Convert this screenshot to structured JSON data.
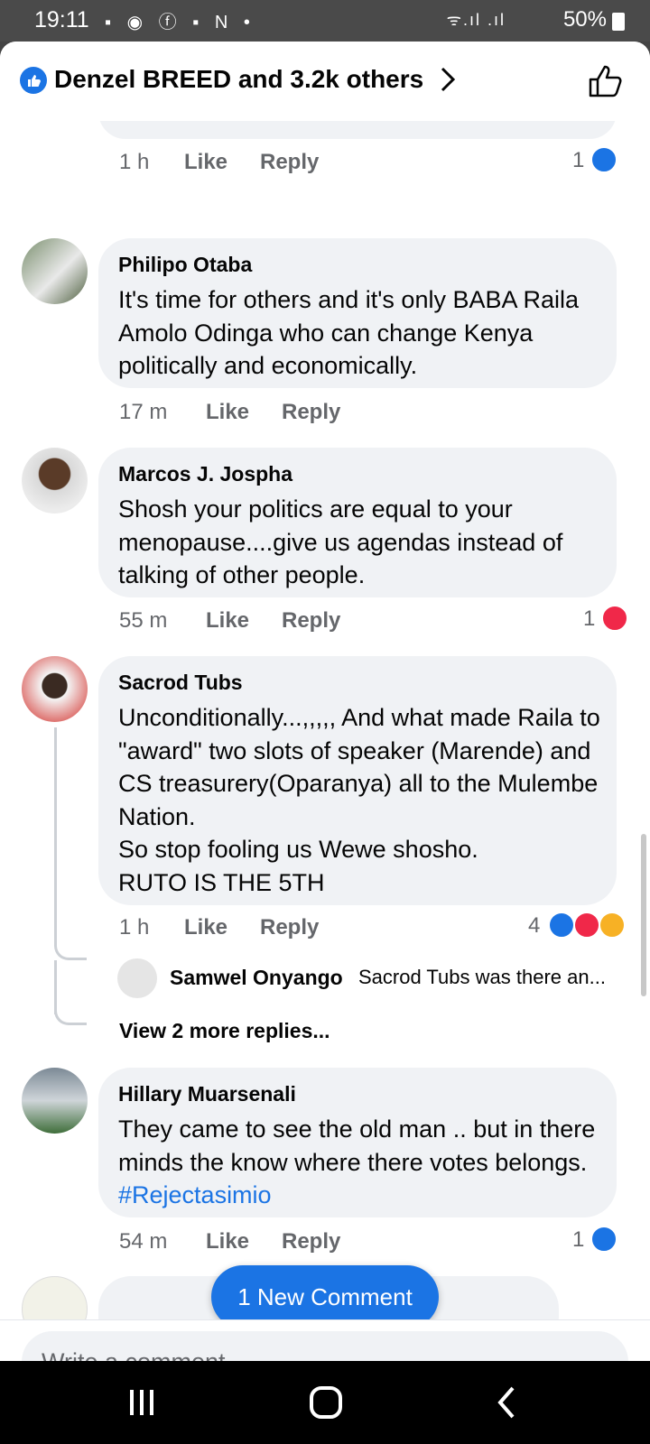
{
  "status_bar": {
    "time": "19:11",
    "notif_icons": "▪ ◉ ⓕ ▪ N •",
    "battery": "50%",
    "signal": "ᯤ.ıl .ıl"
  },
  "header": {
    "reactions_summary": "Denzel BREED and 3.2k others"
  },
  "comments": [
    {
      "time": "1 h",
      "like": "Like",
      "reply": "Reply",
      "reaction_count": "1"
    },
    {
      "author": "Philipo Otaba",
      "text": "It's time for others and it's only BABA Raila Amolo Odinga who can change Kenya politically and economically.",
      "time": "17 m",
      "like": "Like",
      "reply": "Reply"
    },
    {
      "author": "Marcos J. Jospha",
      "text": "Shosh your politics are equal to your menopause....give us agendas instead of talking of other people.",
      "time": "55 m",
      "like": "Like",
      "reply": "Reply",
      "reaction_count": "1"
    },
    {
      "author": "Sacrod Tubs",
      "text": "Unconditionally...,,,,, And what made Raila to \"award\" two slots of speaker (Marende) and CS treasurery(Oparanya) all to the Mulembe Nation.\nSo stop fooling us Wewe shosho.\nRUTO IS THE 5TH",
      "time": "1 h",
      "like": "Like",
      "reply": "Reply",
      "reaction_count": "4"
    },
    {
      "author": "Hillary Muarsenali",
      "text": "They came to see the old man .. but in there minds the know where there votes belongs.",
      "hashtag": "#Rejectasimio",
      "time": "54 m",
      "like": "Like",
      "reply": "Reply",
      "reaction_count": "1"
    }
  ],
  "reply_preview": {
    "author": "Samwel Onyango",
    "text": "Sacrod Tubs was there an..."
  },
  "view_more": "View 2 more replies...",
  "new_comment_button": "1 New Comment",
  "compose": {
    "placeholder": "Write a comment..."
  },
  "colors": {
    "accent": "#1b74e4",
    "love": "#f02849",
    "haha": "#f7b125"
  }
}
